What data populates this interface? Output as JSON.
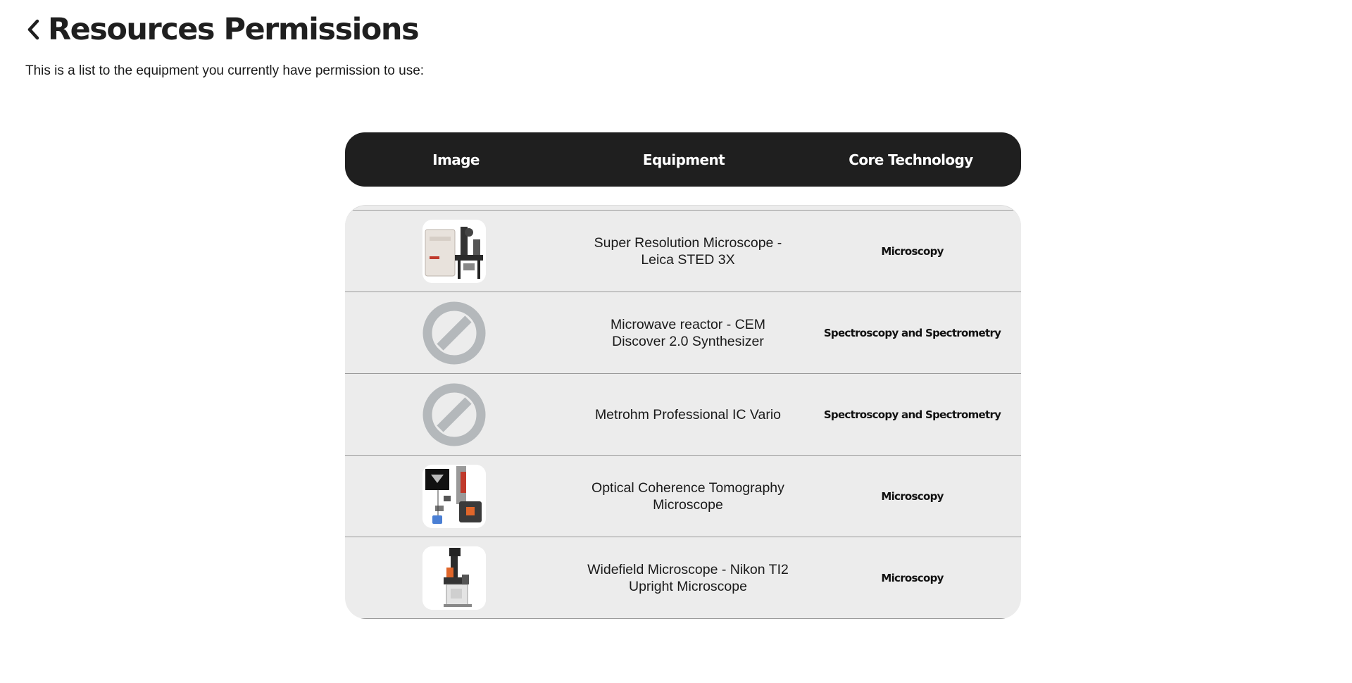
{
  "header": {
    "back_icon": "chevron-left-icon",
    "title": "Resources Permissions"
  },
  "subtitle": "This is a list to the equipment you currently have permission to use:",
  "table": {
    "columns": [
      "Image",
      "Equipment",
      "Core Technology"
    ],
    "rows": [
      {
        "image": "microscope-photo",
        "equipment": "Super Resolution Microscope - Leica STED 3X",
        "core_technology": "Microscopy"
      },
      {
        "image": "no-image-icon",
        "equipment": "Microwave reactor - CEM Discover 2.0 Synthesizer",
        "core_technology": "Spectroscopy and Spectrometry"
      },
      {
        "image": "no-image-icon",
        "equipment": "Metrohm Professional IC Vario",
        "core_technology": "Spectroscopy and Spectrometry"
      },
      {
        "image": "oct-microscope-photo",
        "equipment": "Optical Coherence Tomography Microscope",
        "core_technology": "Microscopy"
      },
      {
        "image": "widefield-microscope-photo",
        "equipment": "Widefield Microscope - Nikon TI2 Upright Microscope",
        "core_technology": "Microscopy"
      }
    ]
  },
  "colors": {
    "header_bg": "#1f1f1f",
    "body_bg": "#ececec",
    "placeholder_gray": "#b4b8bb"
  }
}
